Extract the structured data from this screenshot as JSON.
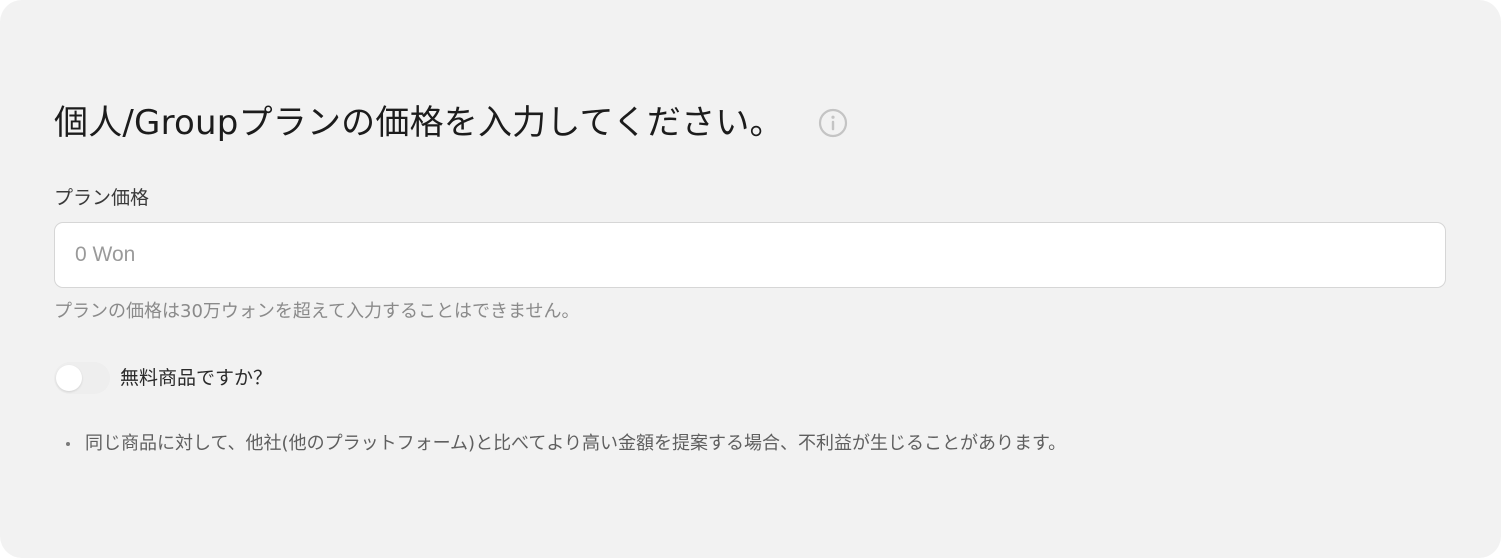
{
  "header": {
    "title": "個人/Groupプランの価格を入力してください。",
    "info_icon": "info-circle-icon"
  },
  "price_field": {
    "label": "プラン価格",
    "value": "",
    "placeholder": "0 Won",
    "hint": "プランの価格は30万ウォンを超えて入力することはできません。"
  },
  "free_toggle": {
    "label": "無料商品ですか？",
    "checked": false
  },
  "notes": [
    "同じ商品に対して、他社(他のプラットフォーム)と比べてより高い金額を提案する場合、不利益が生じることがあります。"
  ],
  "colors": {
    "card_background": "#f2f2f2",
    "input_background": "#ffffff",
    "input_border": "#d6d6d6",
    "hint_text": "#8a8a8a",
    "toggle_off": "#eeeeee"
  }
}
